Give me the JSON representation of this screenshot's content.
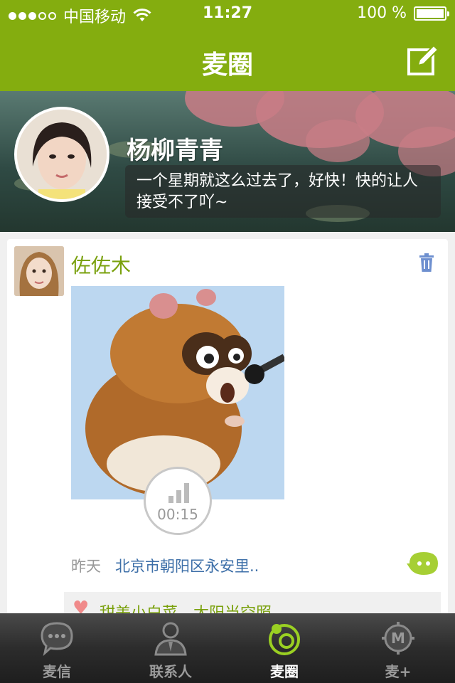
{
  "status_bar": {
    "carrier": "中国移动",
    "time": "11:27",
    "battery": "100 %",
    "signal_bars": 3
  },
  "nav": {
    "title": "麦圈",
    "compose_icon": "compose-icon"
  },
  "profile": {
    "name": "杨柳青青",
    "signature": "一个星期就这么过去了，好快！快的让人接受不了吖~"
  },
  "post": {
    "author": "佐佐木",
    "voice_duration": "00:15",
    "time": "昨天",
    "location": "北京市朝阳区永安里..",
    "likes_text": "甜美小白菜，太阳当空照"
  },
  "tabs": [
    {
      "label": "麦信",
      "icon": "chat-bubble-icon",
      "active": false
    },
    {
      "label": "联系人",
      "icon": "contacts-icon",
      "active": false
    },
    {
      "label": "麦圈",
      "icon": "circle-icon",
      "active": true
    },
    {
      "label": "麦+",
      "icon": "m-plus-icon",
      "active": false
    }
  ],
  "colors": {
    "brand_green": "#84ad0f",
    "link_blue": "#3d6fa8",
    "like_red": "#f08a8a"
  }
}
